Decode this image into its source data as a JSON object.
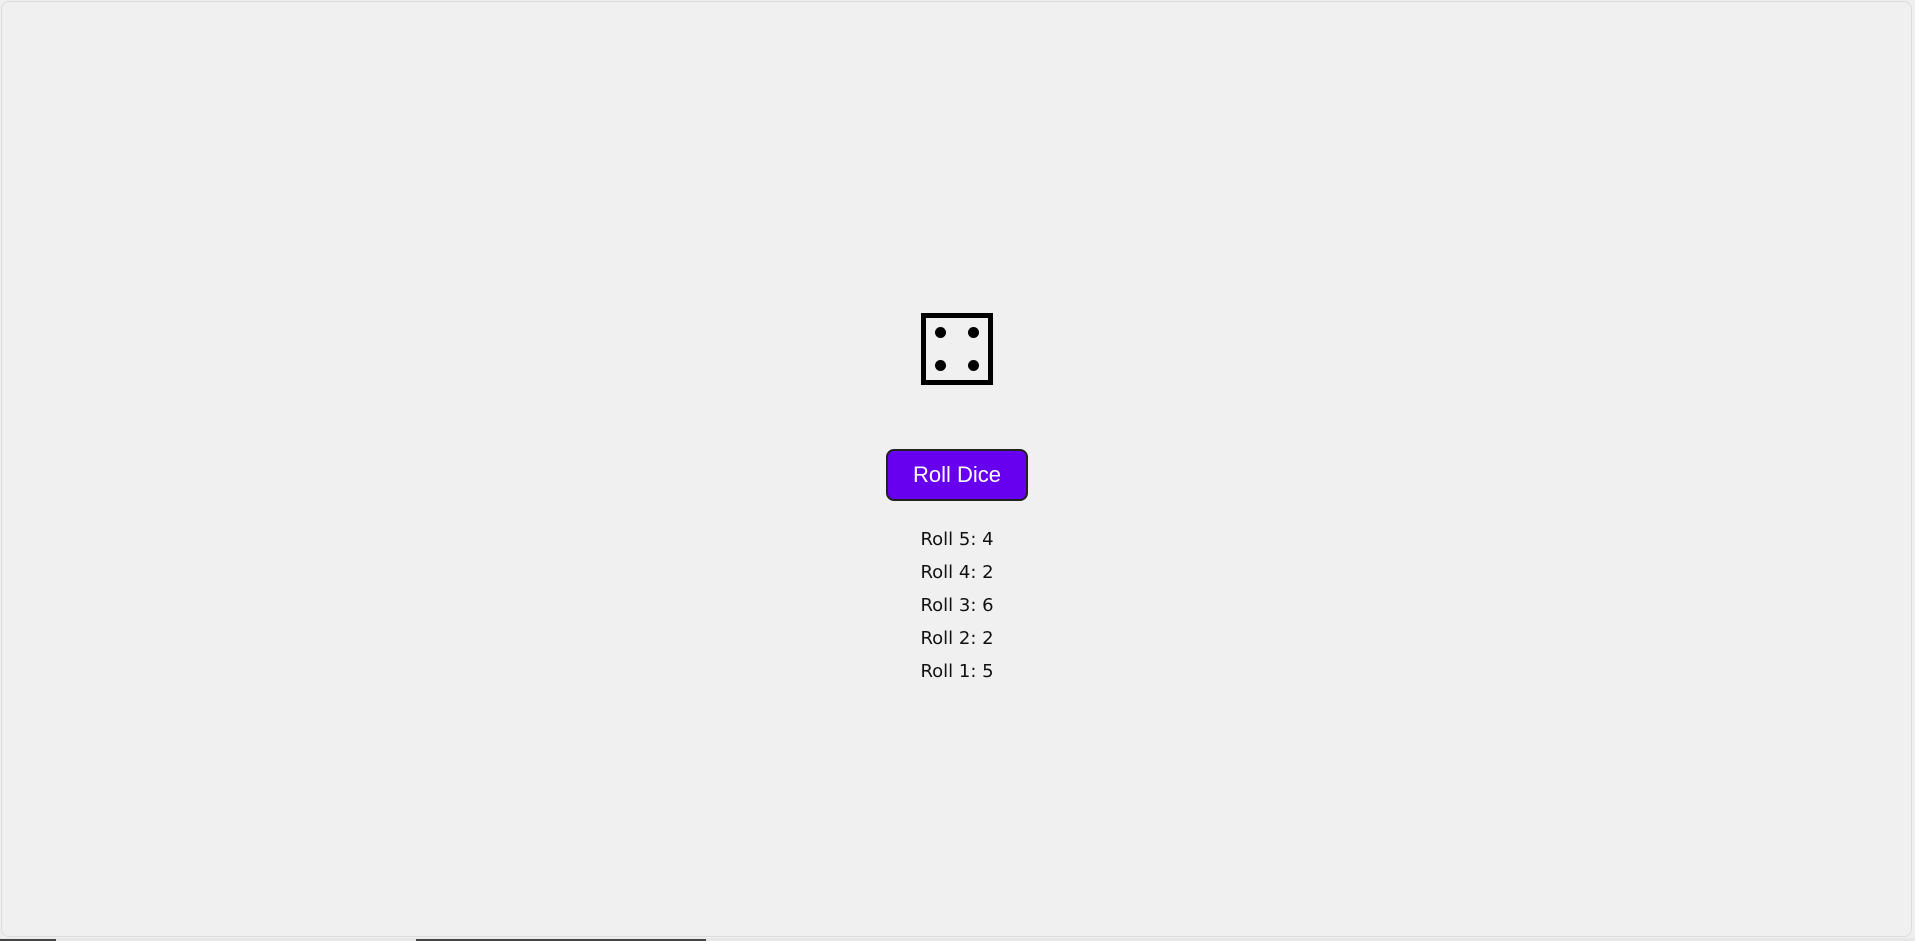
{
  "die": {
    "icon": "die-face-4-icon",
    "current_value": 4
  },
  "roll_button": {
    "label": "Roll Dice",
    "color": "#6600ee"
  },
  "history": [
    "Roll 5: 4",
    "Roll 4: 2",
    "Roll 3: 6",
    "Roll 2: 2",
    "Roll 1: 5"
  ]
}
